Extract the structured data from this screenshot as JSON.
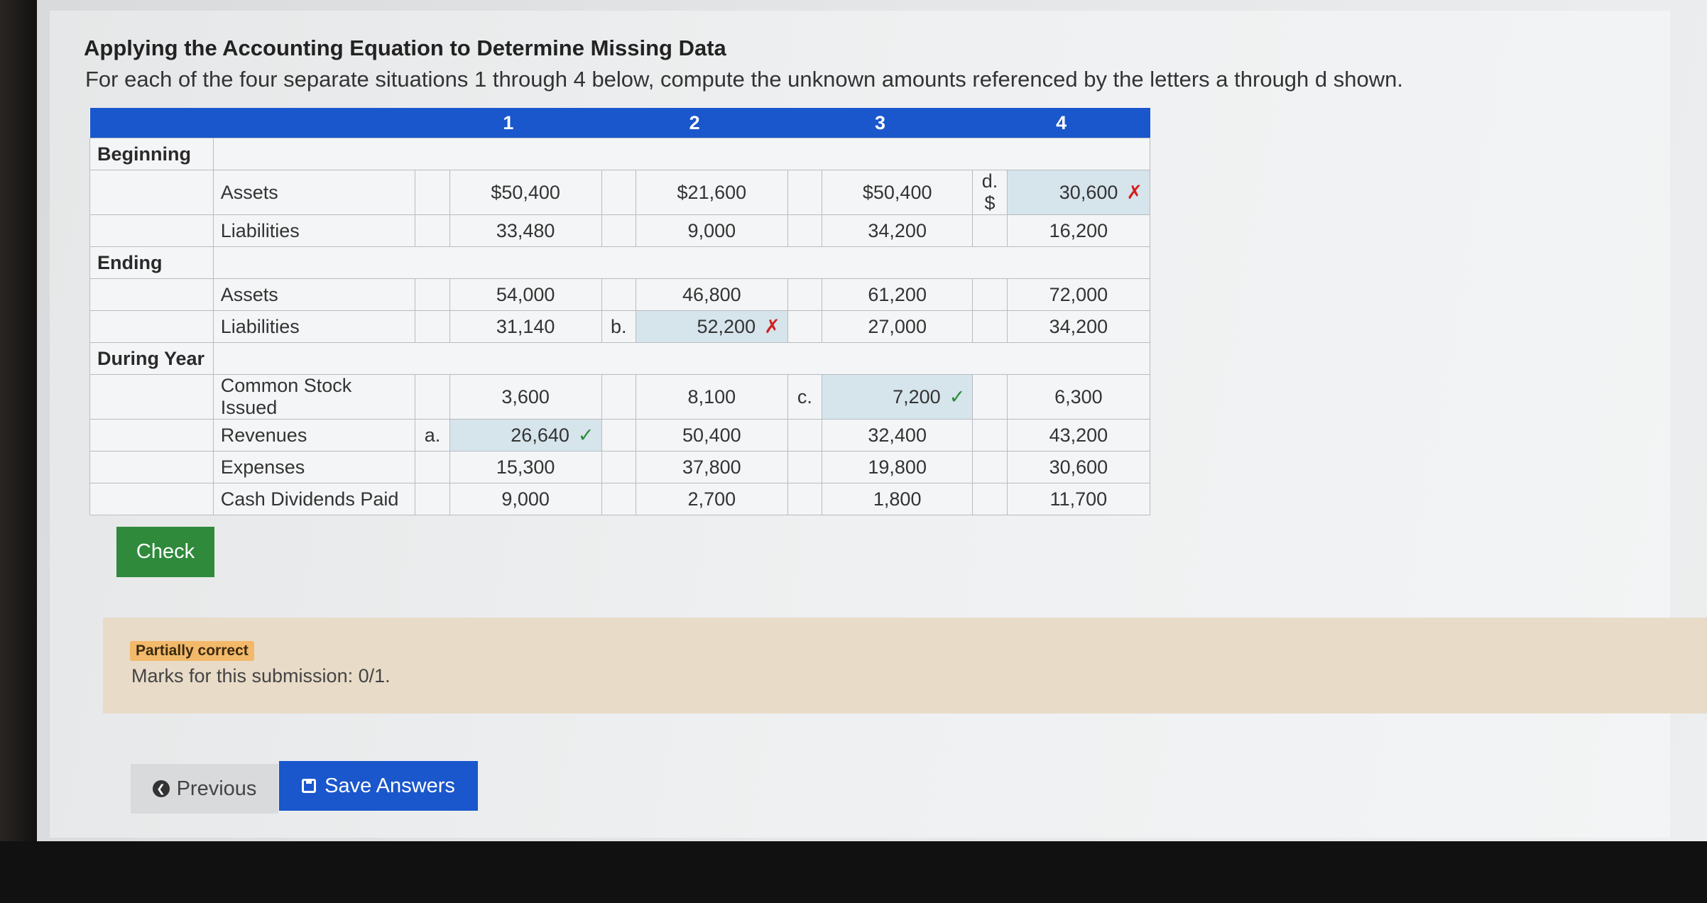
{
  "title": "Applying the Accounting Equation to Determine Missing Data",
  "subtitle": "For each of the four separate situations 1 through 4 below, compute the unknown amounts referenced by the letters a through d shown.",
  "table": {
    "columns": [
      "1",
      "2",
      "3",
      "4"
    ],
    "beginning": {
      "label": "Beginning",
      "assets": {
        "label": "Assets",
        "c1": "$50,400",
        "c2": "$21,600",
        "c3": "$50,400",
        "key4": "d.",
        "dollar4": "$",
        "c4": "30,600",
        "mark4": "✗"
      },
      "liabilities": {
        "label": "Liabilities",
        "c1": "33,480",
        "c2": "9,000",
        "c3": "34,200",
        "c4": "16,200"
      }
    },
    "ending": {
      "label": "Ending",
      "assets": {
        "label": "Assets",
        "c1": "54,000",
        "c2": "46,800",
        "c3": "61,200",
        "c4": "72,000"
      },
      "liabilities": {
        "label": "Liabilities",
        "c1": "31,140",
        "key2": "b.",
        "c2": "52,200",
        "mark2": "✗",
        "c3": "27,000",
        "c4": "34,200"
      }
    },
    "during": {
      "label": "During Year",
      "stock": {
        "label": "Common Stock Issued",
        "c1": "3,600",
        "c2": "8,100",
        "key3": "c.",
        "c3": "7,200",
        "mark3": "✓",
        "c4": "6,300"
      },
      "revenues": {
        "label": "Revenues",
        "key1": "a.",
        "c1": "26,640",
        "mark1": "✓",
        "c2": "50,400",
        "c3": "32,400",
        "c4": "43,200"
      },
      "expenses": {
        "label": "Expenses",
        "c1": "15,300",
        "c2": "37,800",
        "c3": "19,800",
        "c4": "30,600"
      },
      "dividends": {
        "label": "Cash Dividends Paid",
        "c1": "9,000",
        "c2": "2,700",
        "c3": "1,800",
        "c4": "11,700"
      }
    }
  },
  "check_label": "Check",
  "feedback": {
    "badge": "Partially correct",
    "marks": "Marks for this submission: 0/1."
  },
  "buttons": {
    "previous": "Previous",
    "save": "Save Answers"
  },
  "colors": {
    "header_blue": "#1a56cc",
    "check_green": "#2f8a3c",
    "incorrect_red": "#d32020",
    "correct_green": "#2a8a3a",
    "badge_orange": "#f3b96a"
  }
}
